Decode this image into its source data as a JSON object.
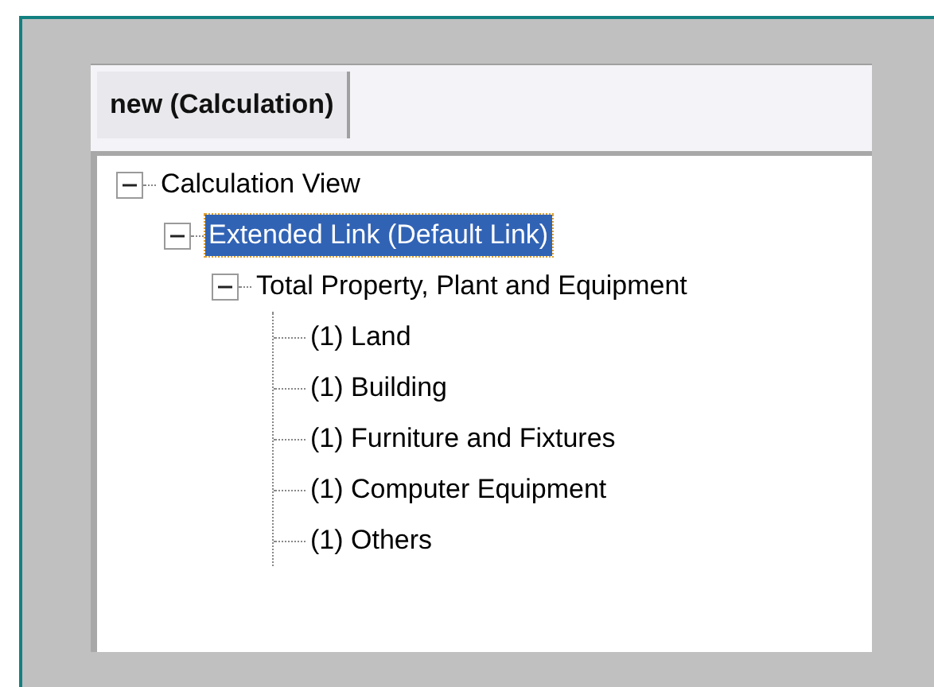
{
  "tabs": [
    {
      "label": "new (Calculation)",
      "selected": true
    }
  ],
  "tree": [
    {
      "label": "Calculation View",
      "expanded": true,
      "selected": false,
      "children": [
        {
          "label": "Extended Link (Default Link)",
          "expanded": true,
          "selected": true,
          "children": [
            {
              "label": "Total Property, Plant and Equipment",
              "expanded": true,
              "selected": false,
              "children": [
                {
                  "label": "(1) Land",
                  "selected": false
                },
                {
                  "label": "(1) Building",
                  "selected": false
                },
                {
                  "label": "(1) Furniture and Fixtures",
                  "selected": false
                },
                {
                  "label": "(1) Computer Equipment",
                  "selected": false
                },
                {
                  "label": "(1) Others",
                  "selected": false
                }
              ]
            }
          ]
        }
      ]
    }
  ]
}
